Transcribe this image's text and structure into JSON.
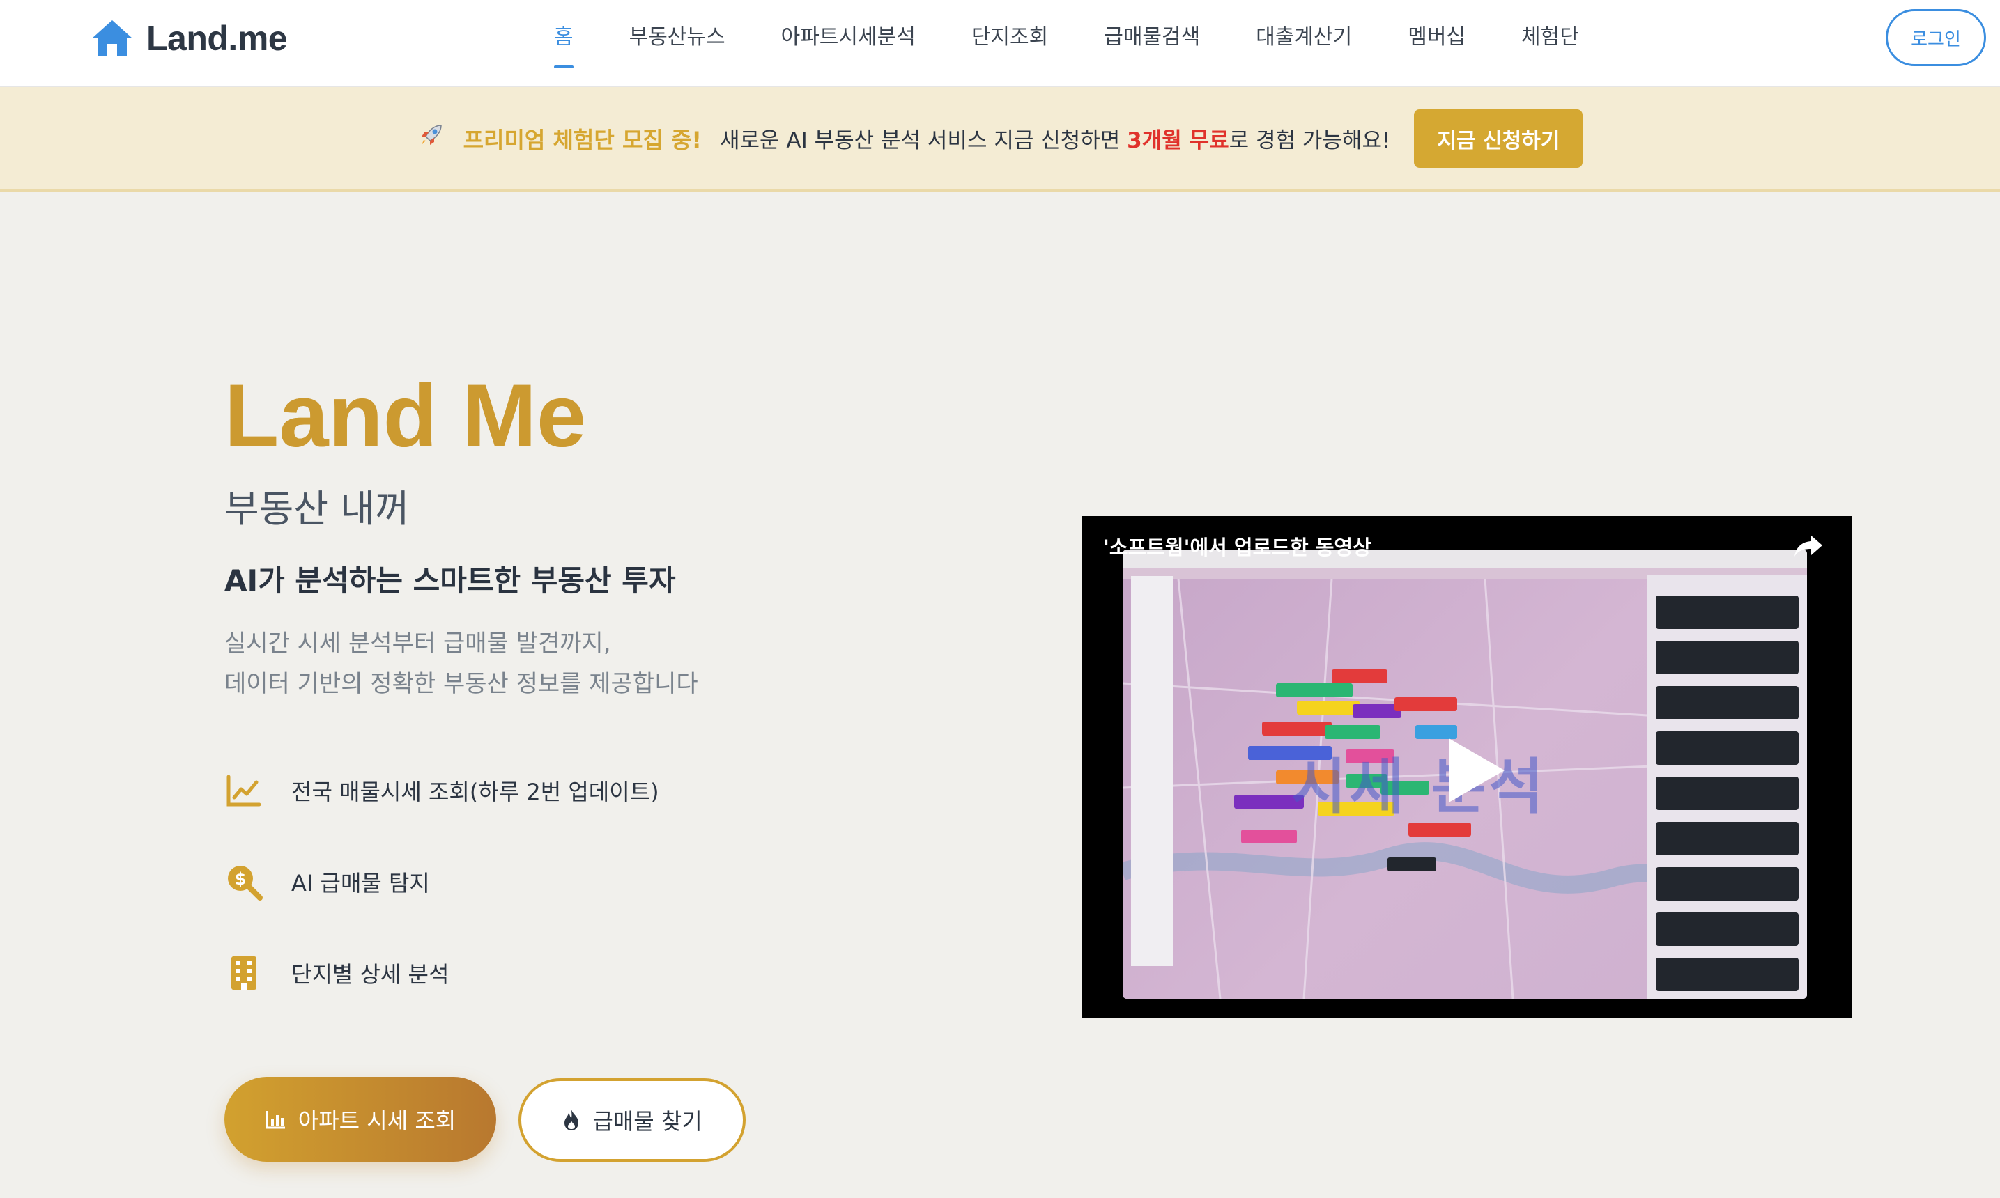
{
  "nav": {
    "logo_text": "Land.me",
    "items": [
      {
        "label": "홈"
      },
      {
        "label": "부동산뉴스"
      },
      {
        "label": "아파트시세분석"
      },
      {
        "label": "단지조회"
      },
      {
        "label": "급매물검색"
      },
      {
        "label": "대출계산기"
      },
      {
        "label": "멤버십"
      },
      {
        "label": "체험단"
      }
    ],
    "active_index": 0,
    "login_label": "로그인"
  },
  "banner": {
    "highlight": "프리미엄 체험단 모집 중!",
    "text_before": "새로운 AI 부동산 분석 서비스 지금 신청하면 ",
    "text_red": "3개월 무료",
    "text_after": "로 경험 가능해요!",
    "button_label": "지금 신청하기"
  },
  "hero": {
    "title": "Land Me",
    "subtitle": "부동산 내꺼",
    "tagline": "AI가 분석하는 스마트한 부동산 투자",
    "description_line1": "실시간 시세 분석부터 급매물 발견까지,",
    "description_line2": "데이터 기반의 정확한 부동산 정보를 제공합니다",
    "features": [
      {
        "label": "전국 매물시세 조회(하루 2번 업데이트)",
        "icon": "chart-line-icon"
      },
      {
        "label": "AI 급매물 탐지",
        "icon": "search-dollar-icon"
      },
      {
        "label": "단지별 상세 분석",
        "icon": "building-icon"
      }
    ],
    "primary_button": "아파트 시세 조회",
    "secondary_button": "급매물 찾기"
  },
  "video": {
    "title": "'소프트웜'에서 업로드한 동영상",
    "overlay_text": "시세 분석"
  },
  "colors": {
    "accent_gold": "#d3a230",
    "accent_blue": "#3b8ee0",
    "banner_bg": "#f4ecd4",
    "alert_red": "#e0322b"
  }
}
